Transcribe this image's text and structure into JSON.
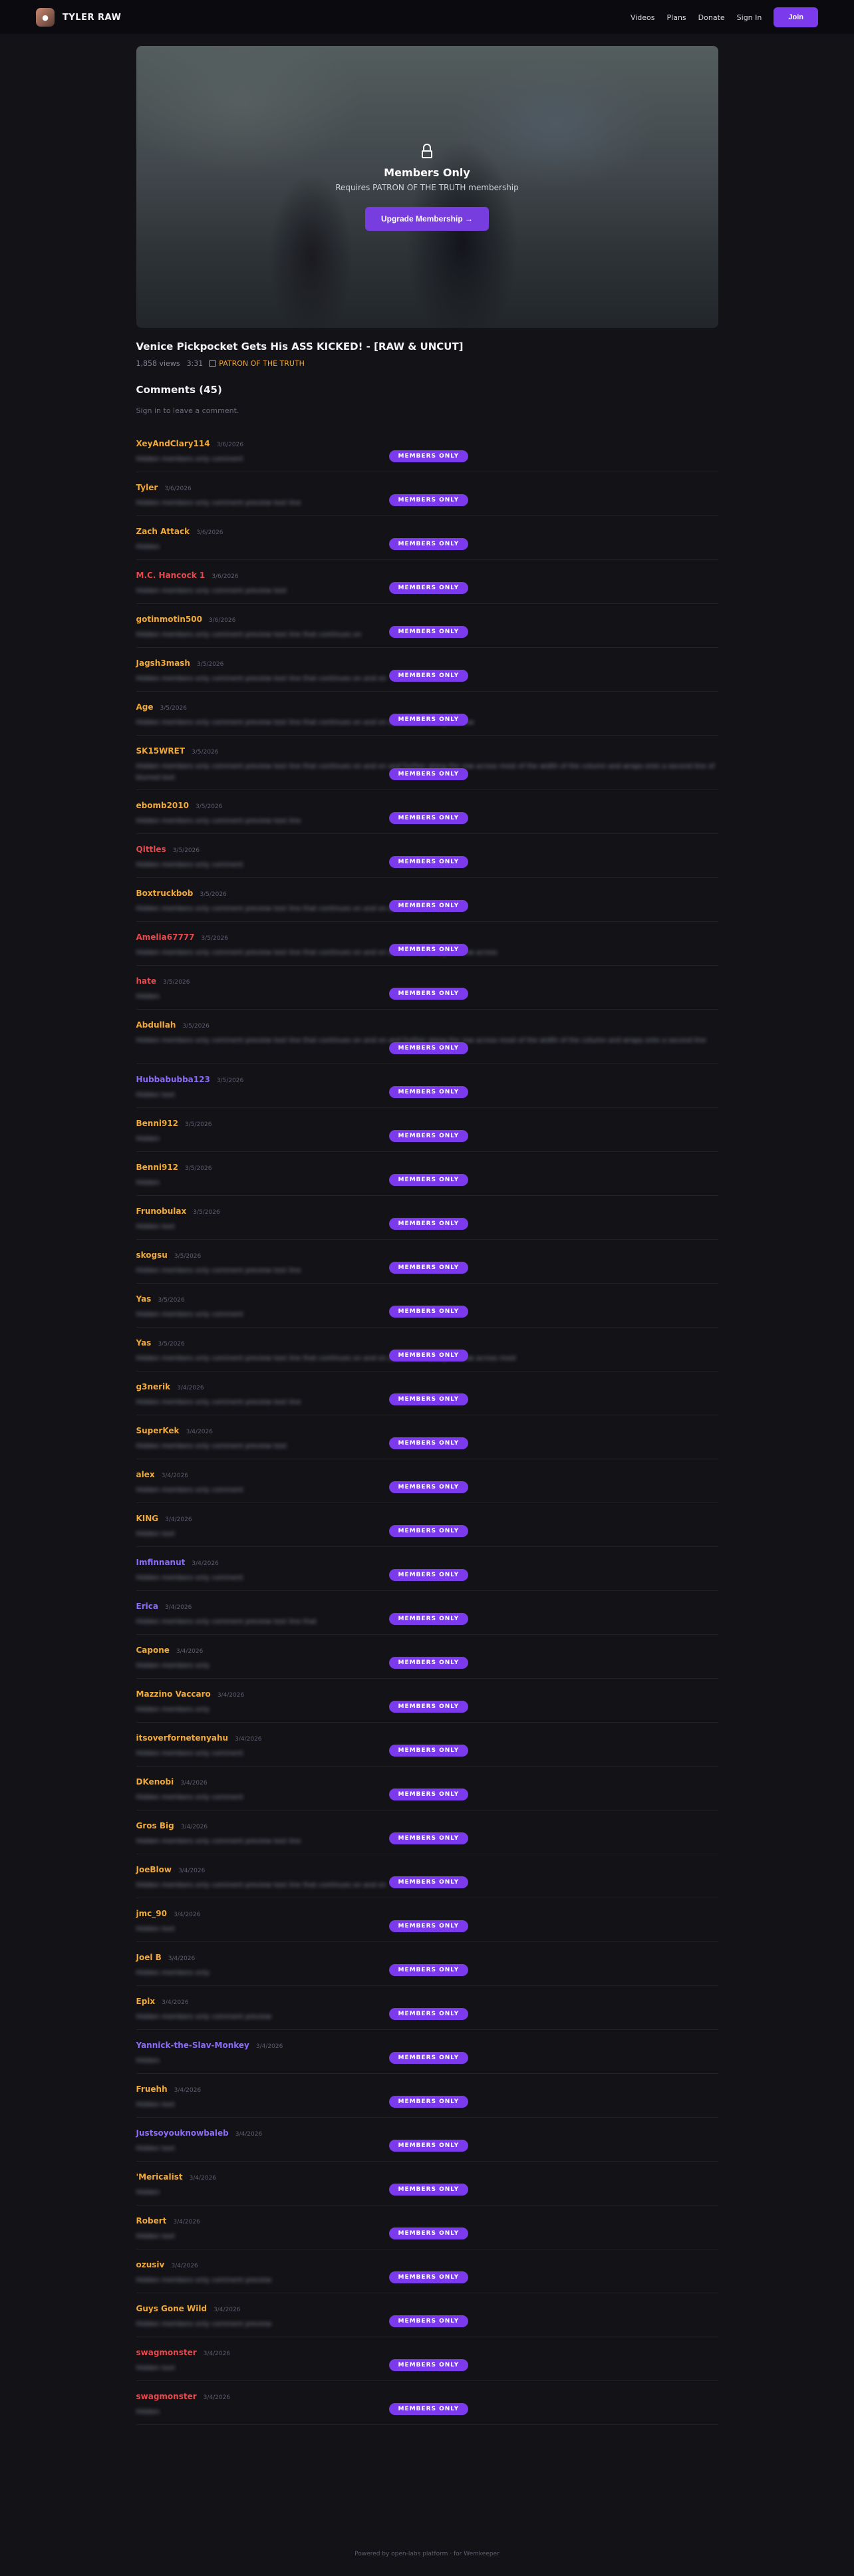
{
  "header": {
    "brand": "TYLER RAW",
    "nav": [
      "Videos",
      "Plans",
      "Donate",
      "Sign In"
    ],
    "join_label": "Join"
  },
  "player": {
    "locked_title": "Members Only",
    "locked_subtitle": "Requires PATRON OF THE TRUTH membership",
    "upgrade_label": "Upgrade Membership →"
  },
  "video": {
    "title": "Venice Pickpocket Gets His ASS KICKED! - [RAW & UNCUT]",
    "views": "1,858 views",
    "duration": "3:31",
    "tier": "PATRON OF THE TRUTH"
  },
  "comments_section": {
    "heading": "Comments (45)",
    "signin_note": "Sign in to leave a comment."
  },
  "badge_label": "MEMBERS ONLY",
  "comments": [
    {
      "author": "XeyAndClary114",
      "date": "3/6/2026",
      "color": "orange",
      "text": "Hidden members only comment"
    },
    {
      "author": "Tyler",
      "date": "3/6/2026",
      "color": "orange",
      "text": "Hidden members only comment preview text line"
    },
    {
      "author": "Zach Attack",
      "date": "3/6/2026",
      "color": "orange",
      "text": "Hidden"
    },
    {
      "author": "M.C. Hancock 1",
      "date": "3/6/2026",
      "color": "red",
      "text": "Hidden members only comment preview text"
    },
    {
      "author": "gotinmotin500",
      "date": "3/6/2026",
      "color": "orange",
      "text": "Hidden members only comment preview text line that continues on"
    },
    {
      "author": "Jagsh3mash",
      "date": "3/5/2026",
      "color": "orange",
      "text": "Hidden members only comment preview text line that continues on and on"
    },
    {
      "author": "Age",
      "date": "3/5/2026",
      "color": "orange",
      "text": "Hidden members only comment preview text line that continues on and on and further along the row"
    },
    {
      "author": "SK15WRET",
      "date": "3/5/2026",
      "color": "orange",
      "text": "Hidden members only comment preview text line that continues on and on and further along the row across most of the width of the column and wraps onto a second line of blurred text"
    },
    {
      "author": "ebomb2010",
      "date": "3/5/2026",
      "color": "orange",
      "text": "Hidden members only comment preview text line"
    },
    {
      "author": "Qittles",
      "date": "3/5/2026",
      "color": "red",
      "text": "Hidden members only comment"
    },
    {
      "author": "Boxtruckbob",
      "date": "3/5/2026",
      "color": "orange",
      "text": "Hidden members only comment preview text line that continues on and on and further"
    },
    {
      "author": "Amelia67777",
      "date": "3/5/2026",
      "color": "red",
      "text": "Hidden members only comment preview text line that continues on and on and further along the row across"
    },
    {
      "author": "hate",
      "date": "3/5/2026",
      "color": "red",
      "text": "Hidden"
    },
    {
      "author": "Abdullah",
      "date": "3/5/2026",
      "color": "orange",
      "text": "Hidden members only comment preview text line that continues on and on and further along the row across most of the width of the column and wraps onto a second line"
    },
    {
      "author": "Hubbabubba123",
      "date": "3/5/2026",
      "color": "purple",
      "text": "Hidden text"
    },
    {
      "author": "Benni912",
      "date": "3/5/2026",
      "color": "orange",
      "text": "Hidden"
    },
    {
      "author": "Benni912",
      "date": "3/5/2026",
      "color": "orange",
      "text": "Hidden"
    },
    {
      "author": "Frunobulax",
      "date": "3/5/2026",
      "color": "orange",
      "text": "Hidden text"
    },
    {
      "author": "skogsu",
      "date": "3/5/2026",
      "color": "orange",
      "text": "Hidden members only comment preview text line"
    },
    {
      "author": "Yas",
      "date": "3/5/2026",
      "color": "orange",
      "text": "Hidden members only comment"
    },
    {
      "author": "Yas",
      "date": "3/5/2026",
      "color": "orange",
      "text": "Hidden members only comment preview text line that continues on and on and further along the row across most"
    },
    {
      "author": "g3nerik",
      "date": "3/4/2026",
      "color": "orange",
      "text": "Hidden members only comment preview text line"
    },
    {
      "author": "SuperKek",
      "date": "3/4/2026",
      "color": "orange",
      "text": "Hidden members only comment preview text"
    },
    {
      "author": "alex",
      "date": "3/4/2026",
      "color": "orange",
      "text": "Hidden members only comment"
    },
    {
      "author": "KING",
      "date": "3/4/2026",
      "color": "orange",
      "text": "Hidden text"
    },
    {
      "author": "Imfinnanut",
      "date": "3/4/2026",
      "color": "purple",
      "text": "Hidden members only comment"
    },
    {
      "author": "Erica",
      "date": "3/4/2026",
      "color": "purple",
      "text": "Hidden members only comment preview text line that"
    },
    {
      "author": "Capone",
      "date": "3/4/2026",
      "color": "orange",
      "text": "Hidden members only"
    },
    {
      "author": "Mazzino Vaccaro",
      "date": "3/4/2026",
      "color": "orange",
      "text": "Hidden members only"
    },
    {
      "author": "itsoverfornetenyahu",
      "date": "3/4/2026",
      "color": "orange",
      "text": "Hidden members only comment"
    },
    {
      "author": "DKenobi",
      "date": "3/4/2026",
      "color": "orange",
      "text": "Hidden members only comment"
    },
    {
      "author": "Gros Big",
      "date": "3/4/2026",
      "color": "orange",
      "text": "Hidden members only comment preview text line"
    },
    {
      "author": "JoeBlow",
      "date": "3/4/2026",
      "color": "orange",
      "text": "Hidden members only comment preview text line that continues on and on"
    },
    {
      "author": "jmc_90",
      "date": "3/4/2026",
      "color": "orange",
      "text": "Hidden text"
    },
    {
      "author": "Joel B",
      "date": "3/4/2026",
      "color": "orange",
      "text": "Hidden members only"
    },
    {
      "author": "Epix",
      "date": "3/4/2026",
      "color": "orange",
      "text": "Hidden members only comment preview"
    },
    {
      "author": "Yannick-the-Slav-Monkey",
      "date": "3/4/2026",
      "color": "purple",
      "text": "Hidden"
    },
    {
      "author": "Fruehh",
      "date": "3/4/2026",
      "color": "orange",
      "text": "Hidden text"
    },
    {
      "author": "Justsoyouknowbaleb",
      "date": "3/4/2026",
      "color": "purple",
      "text": "Hidden text"
    },
    {
      "author": "'Mericalist",
      "date": "3/4/2026",
      "color": "orange",
      "text": "Hidden"
    },
    {
      "author": "Robert",
      "date": "3/4/2026",
      "color": "orange",
      "text": "Hidden text"
    },
    {
      "author": "ozusiv",
      "date": "3/4/2026",
      "color": "orange",
      "text": "Hidden members only comment preview"
    },
    {
      "author": "Guys Gone Wild",
      "date": "3/4/2026",
      "color": "orange",
      "text": "Hidden members only comment preview"
    },
    {
      "author": "swagmonster",
      "date": "3/4/2026",
      "color": "red",
      "text": "Hidden text"
    },
    {
      "author": "swagmonster",
      "date": "3/4/2026",
      "color": "red",
      "text": "Hidden"
    }
  ],
  "footer": "Powered by open-labs platform · for Wemkeeper"
}
